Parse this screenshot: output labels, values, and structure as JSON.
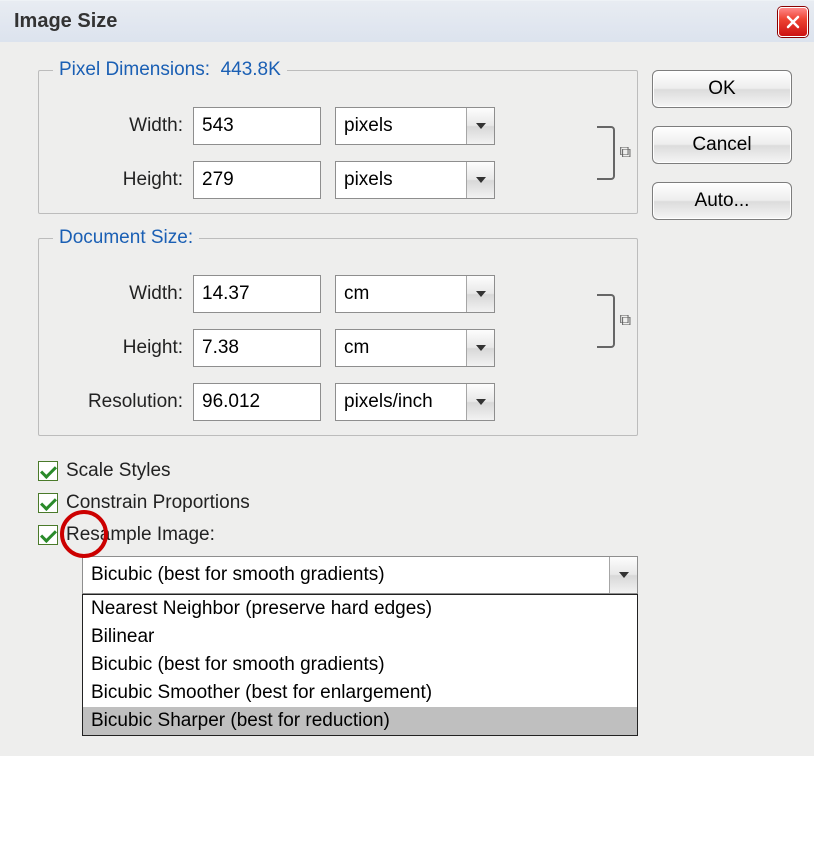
{
  "window": {
    "title": "Image Size"
  },
  "buttons": {
    "ok": "OK",
    "cancel": "Cancel",
    "auto": "Auto..."
  },
  "pixel_dimensions": {
    "legend_prefix": "Pixel Dimensions:",
    "size": "443.8K",
    "width_label": "Width:",
    "width_value": "543",
    "width_unit": "pixels",
    "height_label": "Height:",
    "height_value": "279",
    "height_unit": "pixels"
  },
  "document_size": {
    "legend": "Document Size:",
    "width_label": "Width:",
    "width_value": "14.37",
    "width_unit": "cm",
    "height_label": "Height:",
    "height_value": "7.38",
    "height_unit": "cm",
    "resolution_label": "Resolution:",
    "resolution_value": "96.012",
    "resolution_unit": "pixels/inch"
  },
  "checks": {
    "scale_styles": "Scale Styles",
    "constrain": "Constrain Proportions",
    "resample": "Resample Image:"
  },
  "resample": {
    "selected": "Bicubic (best for smooth gradients)",
    "options": [
      "Nearest Neighbor (preserve hard edges)",
      "Bilinear",
      "Bicubic (best for smooth gradients)",
      "Bicubic Smoother (best for enlargement)",
      "Bicubic Sharper (best for reduction)"
    ]
  }
}
